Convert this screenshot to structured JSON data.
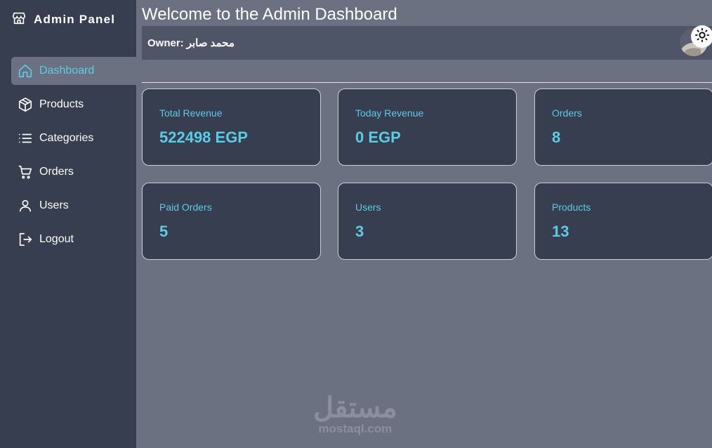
{
  "sidebar": {
    "brand": "Admin Panel",
    "items": [
      {
        "label": "Dashboard",
        "active": true
      },
      {
        "label": "Products"
      },
      {
        "label": "Categories"
      },
      {
        "label": "Orders"
      },
      {
        "label": "Users"
      },
      {
        "label": "Logout"
      }
    ]
  },
  "header": {
    "title": "Welcome to the Admin Dashboard",
    "owner_label": "Owner:",
    "owner_name": "محمد صابر"
  },
  "cards": [
    {
      "label": "Total Revenue",
      "value": "522498 EGP"
    },
    {
      "label": "Today Revenue",
      "value": "0 EGP"
    },
    {
      "label": "Orders",
      "value": "8"
    },
    {
      "label": "Paid Orders",
      "value": "5"
    },
    {
      "label": "Users",
      "value": "3"
    },
    {
      "label": "Products",
      "value": "13"
    }
  ],
  "watermark": {
    "arabic": "مستقل",
    "latin": "mostaql.com"
  },
  "colors": {
    "sidebar_bg": "#363e4f",
    "main_bg": "#6b7180",
    "accent": "#5ccbe6",
    "card_bg": "#363e4f"
  },
  "icons": {
    "brand": "store-icon",
    "nav": [
      "home-icon",
      "box-icon",
      "list-icon",
      "cart-icon",
      "user-icon",
      "logout-icon"
    ],
    "theme": "sun-icon"
  }
}
